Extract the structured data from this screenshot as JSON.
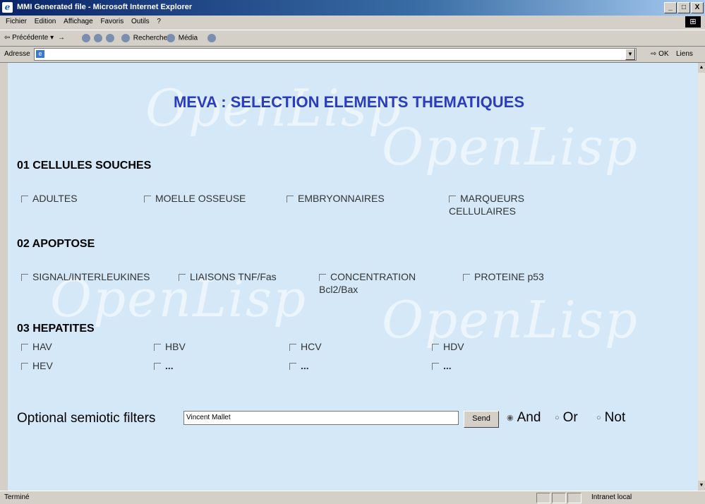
{
  "window": {
    "title": "MMI Generated file - Microsoft Internet Explorer",
    "btn_min": "_",
    "btn_max": "□",
    "btn_close": "X"
  },
  "menubar": {
    "items": [
      "Fichier",
      "Edition",
      "Affichage",
      "Favoris",
      "Outils",
      "?"
    ]
  },
  "toolbar": {
    "back": "Précédente",
    "forward": "→",
    "search": "Rechercher",
    "media": "Média"
  },
  "addressbar": {
    "label": "Adresse",
    "value": "",
    "go": "OK",
    "links": "Liens"
  },
  "page": {
    "title": "MEVA : SELECTION ELEMENTS THEMATIQUES",
    "watermark": "OpenLisp",
    "sections": [
      {
        "title": "01 CELLULES SOUCHES",
        "items": [
          "ADULTES",
          "MOELLE OSSEUSE",
          "EMBRYONNAIRES",
          "MARQUEURS",
          "CELLULAIRES"
        ]
      },
      {
        "title": "02 APOPTOSE",
        "items": [
          "SIGNAL/INTERLEUKINES",
          "LIAISONS TNF/Fas",
          "CONCENTRATION",
          "Bcl2/Bax",
          "PROTEINE p53"
        ]
      },
      {
        "title": "03 HEPATITES",
        "items": [
          "HAV",
          "HBV",
          "HCV",
          "HDV",
          "HEV",
          "...",
          "...",
          "..."
        ]
      }
    ],
    "filter": {
      "label": "Optional semiotic filters",
      "value": "Vincent Mallet",
      "send": "Send",
      "options": [
        "And",
        "Or",
        "Not"
      ],
      "selected": "And"
    }
  },
  "statusbar": {
    "status": "Terminé",
    "zone": "Intranet local"
  }
}
